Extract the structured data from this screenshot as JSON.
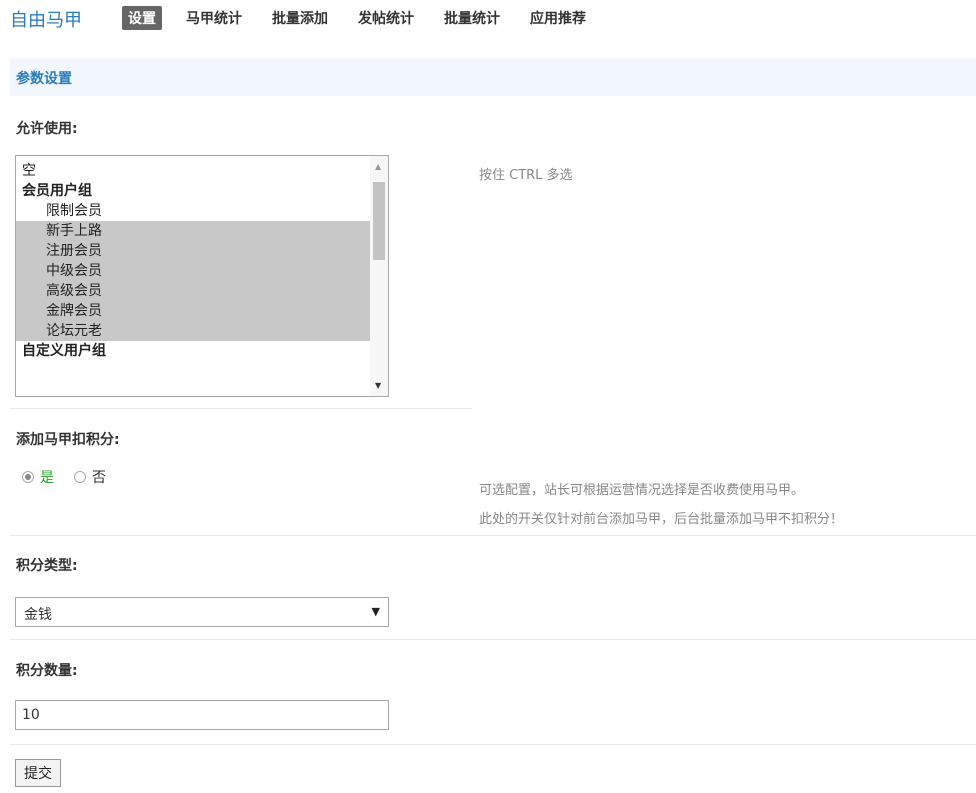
{
  "nav": {
    "brand": "自由马甲",
    "tabs": [
      "设置",
      "马甲统计",
      "批量添加",
      "发帖统计",
      "批量统计",
      "应用推荐"
    ],
    "active_tab": "设置"
  },
  "section": {
    "title": "参数设置"
  },
  "allow": {
    "label": "允许使用:",
    "hint": "按住 CTRL 多选",
    "options": [
      {
        "text": "空",
        "kind": "option",
        "selected": false
      },
      {
        "text": "会员用户组",
        "kind": "group",
        "selected": false
      },
      {
        "text": "限制会员",
        "kind": "sub",
        "selected": false
      },
      {
        "text": "新手上路",
        "kind": "sub",
        "selected": true
      },
      {
        "text": "注册会员",
        "kind": "sub",
        "selected": true
      },
      {
        "text": "中级会员",
        "kind": "sub",
        "selected": true
      },
      {
        "text": "高级会员",
        "kind": "sub",
        "selected": true
      },
      {
        "text": "金牌会员",
        "kind": "sub",
        "selected": true
      },
      {
        "text": "论坛元老",
        "kind": "sub",
        "selected": true
      },
      {
        "text": "自定义用户组",
        "kind": "group",
        "selected": false
      }
    ]
  },
  "deduct": {
    "label": "添加马甲扣积分:",
    "yes": "是",
    "no": "否",
    "selected": "是",
    "hint1": "可选配置，站长可根据运营情况选择是否收费使用马甲。",
    "hint2": "此处的开关仅针对前台添加马甲，后台批量添加马甲不扣积分！"
  },
  "credit_type": {
    "label": "积分类型:",
    "value": "金钱"
  },
  "credit_amount": {
    "label": "积分数量:",
    "value": "10"
  },
  "submit_label": "提交"
}
